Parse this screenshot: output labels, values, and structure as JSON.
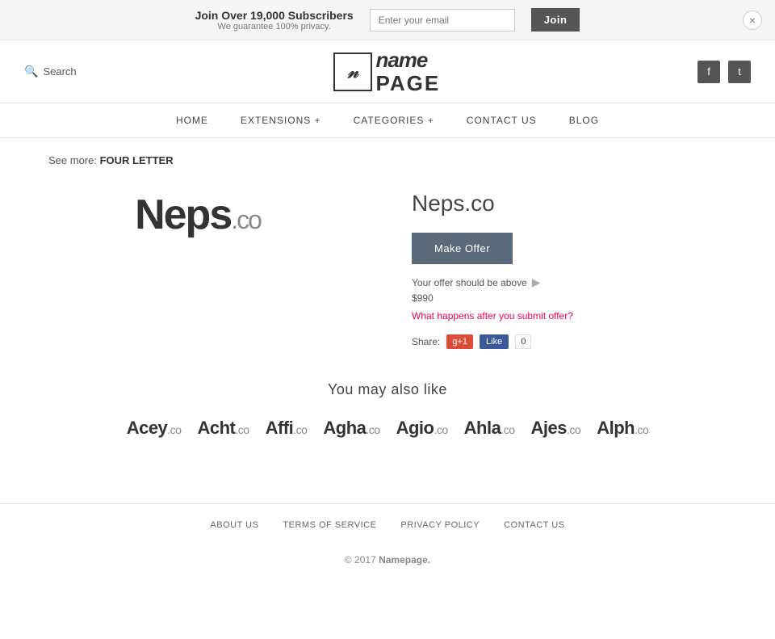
{
  "banner": {
    "headline": "Join Over 19,000 Subscribers",
    "subtext": "We guarantee 100% privacy.",
    "email_placeholder": "Enter your email",
    "join_label": "Join",
    "close_icon": "×"
  },
  "header": {
    "search_label": "Search",
    "logo_icon_char": "n",
    "logo_name": "name",
    "logo_page": "PAGE",
    "facebook_icon": "f",
    "twitter_icon": "t"
  },
  "nav": {
    "items": [
      {
        "label": "HOME",
        "id": "home"
      },
      {
        "label": "EXTENSIONS +",
        "id": "extensions"
      },
      {
        "label": "CATEGORIES +",
        "id": "categories"
      },
      {
        "label": "CONTACT US",
        "id": "contact"
      },
      {
        "label": "BLOG",
        "id": "blog"
      }
    ]
  },
  "breadcrumb": {
    "prefix": "See more:",
    "link_text": "FOUR LETTER"
  },
  "domain": {
    "name": "Neps",
    "tld": ".co",
    "full": "Neps.co",
    "make_offer_label": "Make Offer",
    "offer_hint": "Your offer should be above",
    "offer_price": "$990",
    "offer_link_text": "What happens after you submit offer?",
    "share_label": "Share:",
    "gplus_label": "g+1",
    "fb_label": "Like",
    "fb_count": "0"
  },
  "also_like": {
    "title": "You may also like",
    "items": [
      {
        "name": "Acey",
        "tld": ".co"
      },
      {
        "name": "Acht",
        "tld": ".co"
      },
      {
        "name": "Affi",
        "tld": ".co"
      },
      {
        "name": "Agha",
        "tld": ".co"
      },
      {
        "name": "Agio",
        "tld": ".co"
      },
      {
        "name": "Ahla",
        "tld": ".co"
      },
      {
        "name": "Ajes",
        "tld": ".co"
      },
      {
        "name": "Alph",
        "tld": ".co"
      }
    ]
  },
  "footer": {
    "links": [
      {
        "label": "ABOUT US",
        "id": "about"
      },
      {
        "label": "TERMS OF SERVICE",
        "id": "terms"
      },
      {
        "label": "PRIVACY POLICY",
        "id": "privacy"
      },
      {
        "label": "CONTACT US",
        "id": "contact"
      }
    ],
    "copy_prefix": "© 2017",
    "copy_brand": "Namepage.",
    "copy_suffix": ""
  }
}
